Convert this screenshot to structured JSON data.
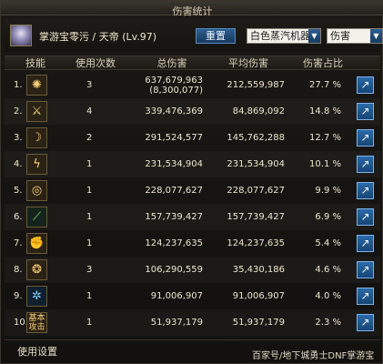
{
  "window": {
    "title": "伤害统计"
  },
  "header": {
    "character": "掌游宝零污 / 天帝 (Lv.97)",
    "reset_label": "重置",
    "source_select": "白色蒸汽机器",
    "type_select": "伤害"
  },
  "columns": [
    "技能",
    "使用次数",
    "总伤害",
    "平均伤害",
    "伤害占比"
  ],
  "rows": [
    {
      "rank": "1.",
      "uses": "3",
      "total": "637,679,963",
      "total_sub": "(8,300,077)",
      "avg": "212,559,987",
      "pct": "27.7 %"
    },
    {
      "rank": "2.",
      "uses": "4",
      "total": "339,476,369",
      "avg": "84,869,092",
      "pct": "14.8 %"
    },
    {
      "rank": "3.",
      "uses": "2",
      "total": "291,524,577",
      "avg": "145,762,288",
      "pct": "12.7 %"
    },
    {
      "rank": "4.",
      "uses": "1",
      "total": "231,534,904",
      "avg": "231,534,904",
      "pct": "10.1 %"
    },
    {
      "rank": "5.",
      "uses": "1",
      "total": "228,077,627",
      "avg": "228,077,627",
      "pct": "9.9 %"
    },
    {
      "rank": "6.",
      "uses": "1",
      "total": "157,739,427",
      "avg": "157,739,427",
      "pct": "6.9 %"
    },
    {
      "rank": "7.",
      "uses": "1",
      "total": "124,237,635",
      "avg": "124,237,635",
      "pct": "5.4 %"
    },
    {
      "rank": "8.",
      "uses": "3",
      "total": "106,290,559",
      "avg": "35,430,186",
      "pct": "4.6 %"
    },
    {
      "rank": "9.",
      "uses": "1",
      "total": "91,006,907",
      "avg": "91,006,907",
      "pct": "4.0 %"
    },
    {
      "rank": "10.",
      "uses": "1",
      "total": "51,937,179",
      "avg": "51,937,179",
      "pct": "2.3 %"
    }
  ],
  "footer": {
    "settings_label": "使用设置",
    "watermark": "百家号/地下城勇士DNF掌游宝"
  },
  "colors": {
    "panel": "#12110f",
    "accent": "#2b6aa8",
    "text": "#efe6cd"
  }
}
